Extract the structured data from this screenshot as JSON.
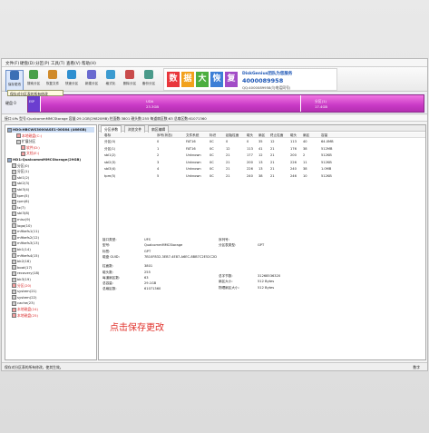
{
  "menu": [
    "文件(F)",
    "硬盘(D)",
    "分区(P)",
    "工具(T)",
    "查看(V)",
    "帮助(H)"
  ],
  "toolbar": {
    "buttons": [
      {
        "label": "保存更改",
        "color": "#3b6fb5"
      },
      {
        "label": "搜索分区",
        "color": "#4aa04a"
      },
      {
        "label": "恢复文件",
        "color": "#d08a2a"
      },
      {
        "label": "快速分区",
        "color": "#2f8fd0"
      },
      {
        "label": "新建分区",
        "color": "#6a6ad0"
      },
      {
        "label": "格式化",
        "color": "#3c9bd0"
      },
      {
        "label": "删除分区",
        "color": "#c94b4b"
      },
      {
        "label": "备份分区",
        "color": "#4a9a8a"
      }
    ],
    "save_tooltip": "保存对分区表的所有修改"
  },
  "banner": {
    "tiles": [
      "数",
      "据",
      "大",
      "恢",
      "复"
    ],
    "tile_colors": [
      "#e9363b",
      "#f2a11b",
      "#4cae3f",
      "#3d7fd6",
      "#a24cc7"
    ],
    "brand": "DiskGenius团队为您服务",
    "phone": "4000089958",
    "qq": "QQ:4000089958(与电话同号)"
  },
  "diskbar": {
    "label": "硬盘 0",
    "partitions": [
      {
        "name": "分区(3)",
        "size": "ESP"
      },
      {
        "name": "UDA",
        "size": "23.3GB"
      },
      {
        "name": "分区(1)",
        "size": "17.4GB"
      }
    ]
  },
  "infobar": "接口:Ufs  型号:QualcommMMCStorage  容量:29.1GB(29820MB)  柱面数:3801  磁头数:255  每道扇区数:63  总扇区数:61071360",
  "tree": [
    {
      "text": "HD0:HBCWS3000ASE1-00S64 (466GB)",
      "indent": 0,
      "color": "#222",
      "bold": true
    },
    {
      "text": "本地磁盘(C:)",
      "indent": 2,
      "color": "#d92a2a"
    },
    {
      "text": "扩展分区",
      "indent": 2,
      "color": "#222"
    },
    {
      "text": "软件(D:)",
      "indent": 3,
      "color": "#d92a2a"
    },
    {
      "text": "文档(E:)",
      "indent": 3,
      "color": "#d92a2a"
    },
    {
      "text": "HD1:QualcommMMCStorage(29GB)",
      "indent": 0,
      "color": "#222",
      "bold": true
    },
    {
      "text": "分区(0)",
      "indent": 1,
      "color": "#222"
    },
    {
      "text": "分区(1)",
      "indent": 1,
      "color": "#222"
    },
    {
      "text": "sbl1(2)",
      "indent": 1,
      "color": "#222"
    },
    {
      "text": "sbl2(3)",
      "indent": 1,
      "color": "#222"
    },
    {
      "text": "sbl3(4)",
      "indent": 1,
      "color": "#222"
    },
    {
      "text": "tpm(5)",
      "indent": 1,
      "color": "#222"
    },
    {
      "text": "rpm(6)",
      "indent": 1,
      "color": "#222"
    },
    {
      "text": "tz(7)",
      "indent": 1,
      "color": "#222"
    },
    {
      "text": "sbl3(8)",
      "indent": 1,
      "color": "#222"
    },
    {
      "text": "misc(9)",
      "indent": 1,
      "color": "#222"
    },
    {
      "text": "logo(10)",
      "indent": 1,
      "color": "#222"
    },
    {
      "text": "m9kefs1(11)",
      "indent": 1,
      "color": "#222"
    },
    {
      "text": "m9kefs2(12)",
      "indent": 1,
      "color": "#222"
    },
    {
      "text": "m9kefs3(13)",
      "indent": 1,
      "color": "#222"
    },
    {
      "text": "bk1(14)",
      "indent": 1,
      "color": "#222"
    },
    {
      "text": "m9kefs4(15)",
      "indent": 1,
      "color": "#222"
    },
    {
      "text": "bk2(16)",
      "indent": 1,
      "color": "#222"
    },
    {
      "text": "boot(17)",
      "indent": 1,
      "color": "#222"
    },
    {
      "text": "recovery(18)",
      "indent": 1,
      "color": "#222"
    },
    {
      "text": "bk3(19)",
      "indent": 1,
      "color": "#222"
    },
    {
      "text": "分区(20)",
      "indent": 1,
      "color": "#d92a2a"
    },
    {
      "text": "system(21)",
      "indent": 1,
      "color": "#222"
    },
    {
      "text": "system(22)",
      "indent": 1,
      "color": "#222"
    },
    {
      "text": "cache(23)",
      "indent": 1,
      "color": "#222"
    },
    {
      "text": "本地磁盘(24)",
      "indent": 1,
      "color": "#d92a2a"
    },
    {
      "text": "本地磁盘(25)",
      "indent": 1,
      "color": "#d92a2a"
    }
  ],
  "tabs": [
    "分区参数",
    "浏览文件",
    "扇区编辑"
  ],
  "table": {
    "headers": [
      "卷标",
      "序号(状态)",
      "文件系统",
      "标识",
      "起始柱面",
      "磁头",
      "扇区",
      "终止柱面",
      "磁头",
      "扇区",
      "容量"
    ],
    "rows": [
      [
        "分区(0)",
        "0",
        "FAT16",
        "0C",
        "0",
        "0",
        "35",
        "12",
        "113",
        "40",
        "64.0MB"
      ],
      [
        "分区(1)",
        "1",
        "FAT16",
        "0C",
        "12",
        "113",
        "41",
        "21",
        "176",
        "38",
        "512MB"
      ],
      [
        "sbl1(2)",
        "2",
        "Unknown",
        "0C",
        "21",
        "177",
        "12",
        "21",
        "200",
        "2",
        "512KB"
      ],
      [
        "sbl2(3)",
        "3",
        "Unknown",
        "0C",
        "21",
        "200",
        "13",
        "21",
        "226",
        "11",
        "512KB"
      ],
      [
        "sbl3(4)",
        "4",
        "Unknown",
        "0C",
        "21",
        "226",
        "13",
        "21",
        "240",
        "38",
        "1.0MB"
      ],
      [
        "tpm(5)",
        "5",
        "Unknown",
        "0C",
        "21",
        "240",
        "38",
        "21",
        "246",
        "10",
        "512KB"
      ]
    ]
  },
  "details": {
    "left": [
      [
        "接口类型:",
        "UFS"
      ],
      [
        "型号:",
        "QualcommMMCStorage"
      ],
      [
        "标签:",
        "GPT"
      ],
      [
        "磁盘 GUID:",
        "7B10F832-3EB7-4E87-A6EC-8BB7C2E52C2D"
      ],
      [
        "柱面数:",
        "3801"
      ],
      [
        "磁头数:",
        "255"
      ],
      [
        "每道扇区数:",
        "63"
      ],
      [
        "总容量:",
        "29.1GB"
      ],
      [
        "总扇区数:",
        "61071360"
      ]
    ],
    "right": [
      [
        "序列号:",
        ""
      ],
      [
        "分区表类型:",
        "GPT"
      ],
      [
        "总字节数:",
        "31268536320"
      ],
      [
        "扇区大小:",
        "512 Bytes"
      ],
      [
        "物理扇区大小:",
        "512 Bytes"
      ]
    ]
  },
  "save_message": "点击保存更改",
  "status": {
    "left": "保存对分区表的所有修改，使其生效。",
    "right": "数字"
  }
}
